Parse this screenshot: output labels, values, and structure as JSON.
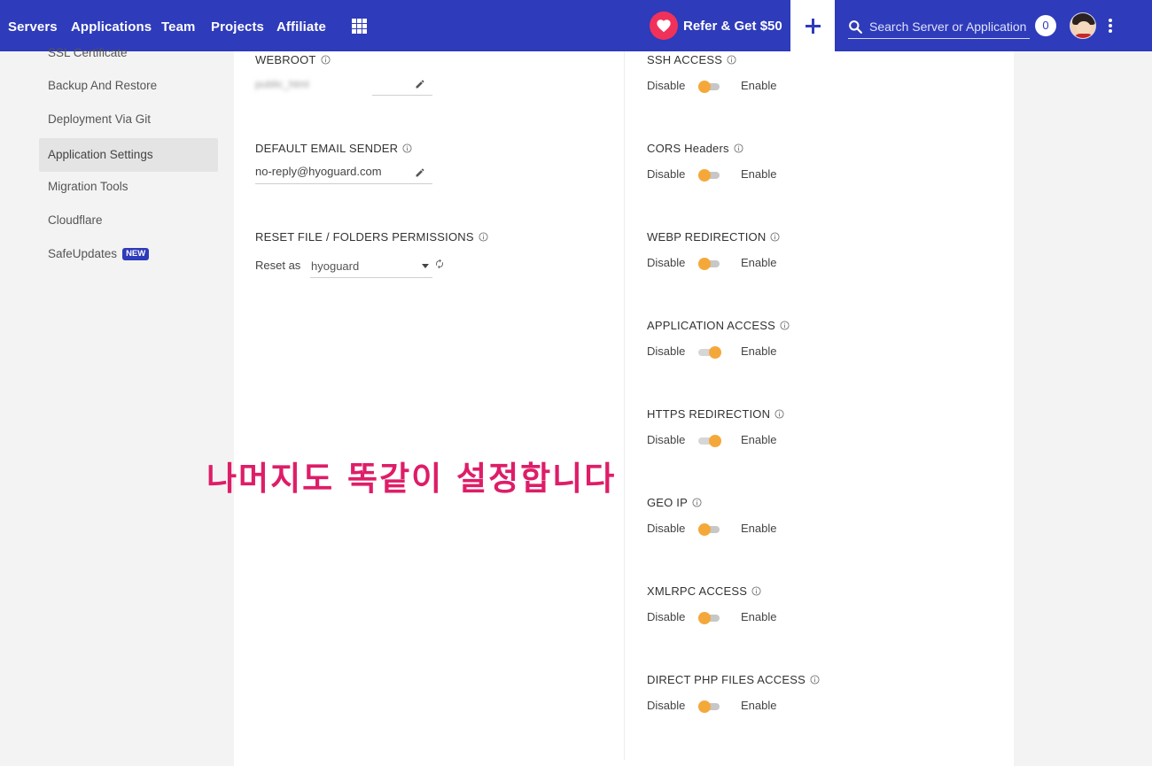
{
  "nav": {
    "items": [
      "Servers",
      "Applications",
      "Team",
      "Projects",
      "Affiliate"
    ],
    "refer_label": "Refer & Get $50",
    "search_placeholder": "Search Server or Application",
    "notification_count": "0"
  },
  "sidebar": {
    "items": [
      {
        "label": "SSL Certificate",
        "active": false
      },
      {
        "label": "Backup And Restore",
        "active": false
      },
      {
        "label": "Deployment Via Git",
        "active": false
      },
      {
        "label": "Application Settings",
        "active": true
      },
      {
        "label": "Migration Tools",
        "active": false
      },
      {
        "label": "Cloudflare",
        "active": false
      },
      {
        "label": "SafeUpdates",
        "active": false,
        "badge": "NEW"
      }
    ]
  },
  "settings": {
    "webroot": {
      "label": "WEBROOT",
      "value": "public_html"
    },
    "email_sender": {
      "label": "DEFAULT EMAIL SENDER",
      "value": "no-reply@hyoguard.com"
    },
    "reset_permissions": {
      "label": "RESET FILE / FOLDERS PERMISSIONS",
      "reset_as_label": "Reset as",
      "selected": "hyoguard"
    }
  },
  "toggle_text": {
    "disable": "Disable",
    "enable": "Enable"
  },
  "toggles": [
    {
      "label": "SSH ACCESS",
      "enabled": false
    },
    {
      "label": "CORS Headers",
      "enabled": false
    },
    {
      "label": "WEBP REDIRECTION",
      "enabled": false
    },
    {
      "label": "APPLICATION ACCESS",
      "enabled": true
    },
    {
      "label": "HTTPS REDIRECTION",
      "enabled": true
    },
    {
      "label": "GEO IP",
      "enabled": false
    },
    {
      "label": "XMLRPC ACCESS",
      "enabled": false
    },
    {
      "label": "DIRECT PHP FILES ACCESS",
      "enabled": false
    }
  ],
  "annotation": "나머지도  똑같이 설정합니다",
  "colors": {
    "nav_bg": "#2e3bba",
    "toggle_knob": "#f5a83a",
    "annotation": "#de1d68",
    "heart_bg": "#f0315a"
  }
}
